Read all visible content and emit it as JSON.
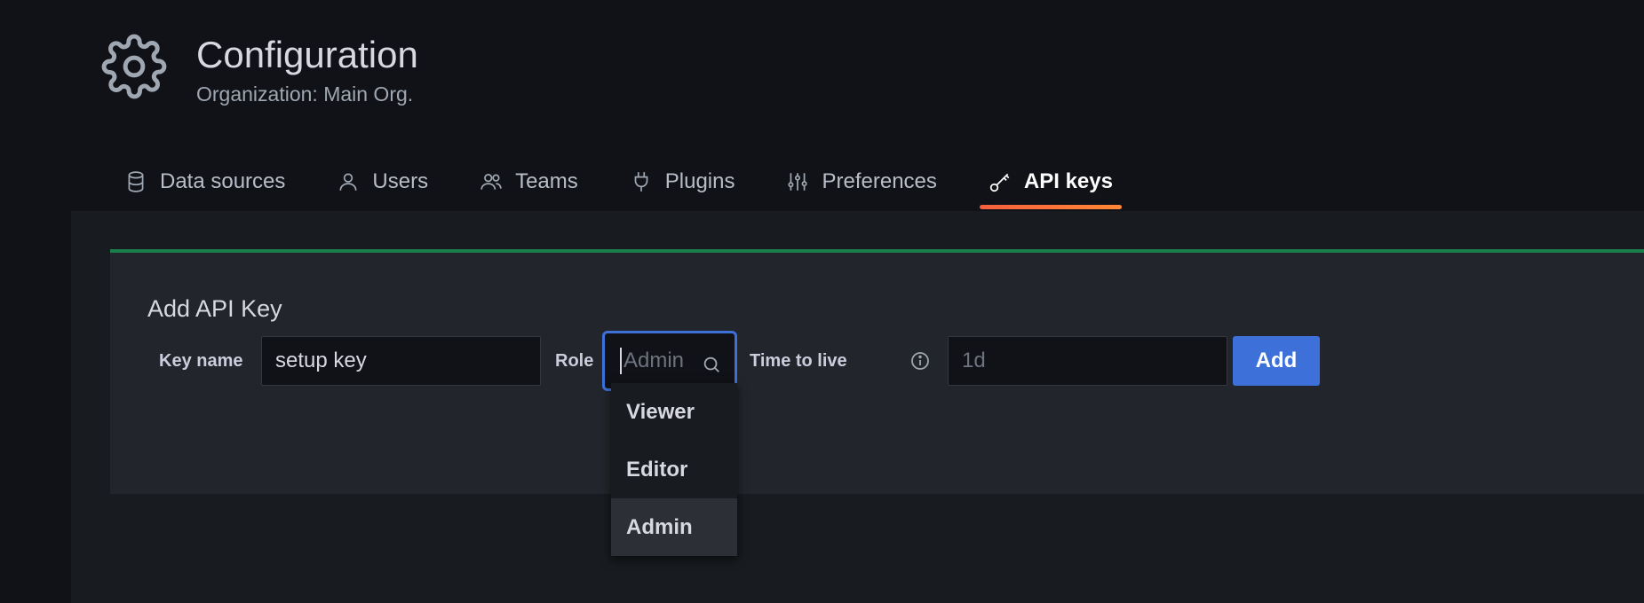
{
  "header": {
    "title": "Configuration",
    "subtitle": "Organization: Main Org.",
    "icon": "gear-icon"
  },
  "tabs": [
    {
      "label": "Data sources",
      "icon": "database-icon",
      "active": false
    },
    {
      "label": "Users",
      "icon": "user-icon",
      "active": false
    },
    {
      "label": "Teams",
      "icon": "users-icon",
      "active": false
    },
    {
      "label": "Plugins",
      "icon": "plug-icon",
      "active": false
    },
    {
      "label": "Preferences",
      "icon": "sliders-icon",
      "active": false
    },
    {
      "label": "API keys",
      "icon": "key-icon",
      "active": true
    }
  ],
  "form": {
    "title": "Add API Key",
    "key_name_label": "Key name",
    "key_name_value": "setup key",
    "role_label": "Role",
    "role_placeholder": "Admin",
    "ttl_label": "Time to live",
    "ttl_placeholder": "1d",
    "add_label": "Add"
  },
  "role_dropdown": {
    "options": [
      "Viewer",
      "Editor",
      "Admin"
    ],
    "selected": "Admin"
  },
  "colors": {
    "accent": "#3d71d9",
    "card_border": "#1a7f4b",
    "tab_underline": "#ff8833"
  }
}
